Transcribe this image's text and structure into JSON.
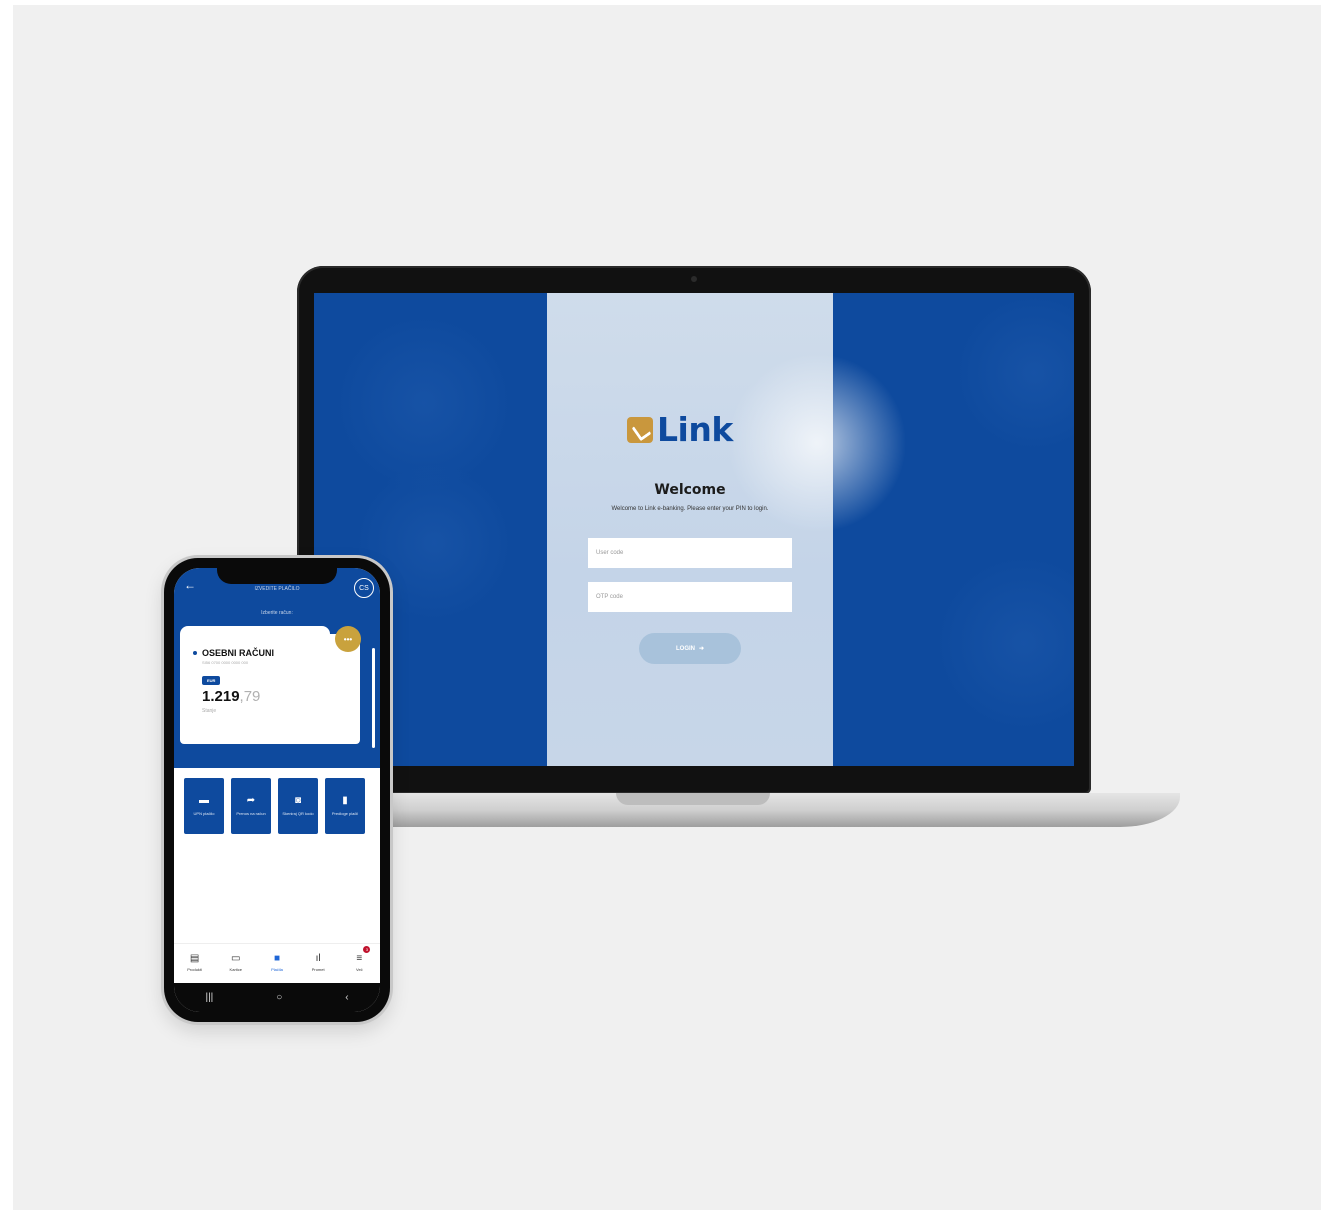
{
  "laptop": {
    "brand": "Link",
    "welcome_title": "Welcome",
    "welcome_subtitle": "Welcome to Link e-banking. Please enter your PIN to login.",
    "user_code_placeholder": "User code",
    "otp_code_placeholder": "OTP code",
    "login_label": "LOGIN",
    "login_arrow": "➜"
  },
  "phone": {
    "back_icon": "←",
    "header_title": "IZVEDITE PLAČILO",
    "avatar_initials": "CS",
    "header_subtitle": "Izberite račun:",
    "more_icon": "•••",
    "account_title": "OSEBNI RAČUNI",
    "account_iban": "SI56 0700 0000 0000 000",
    "currency": "EUR",
    "balance_int": "1.219",
    "balance_dec": ",79",
    "balance_label": "Stanje",
    "actions": [
      {
        "icon": "▬",
        "label": "UPN plačilo"
      },
      {
        "icon": "➦",
        "label": "Prenos na račun"
      },
      {
        "icon": "◙",
        "label": "Skeniraj QR kodo"
      },
      {
        "icon": "▮",
        "label": "Predloge plačil"
      }
    ],
    "nav": [
      {
        "icon": "▤",
        "label": "Produkti"
      },
      {
        "icon": "▭",
        "label": "Kartice"
      },
      {
        "icon": "■",
        "label": "Plačila"
      },
      {
        "icon": "ıl",
        "label": "Promet"
      },
      {
        "icon": "≡",
        "label": "Več"
      }
    ],
    "nav_badge": "3",
    "android_nav": [
      "|||",
      "○",
      "‹"
    ]
  }
}
